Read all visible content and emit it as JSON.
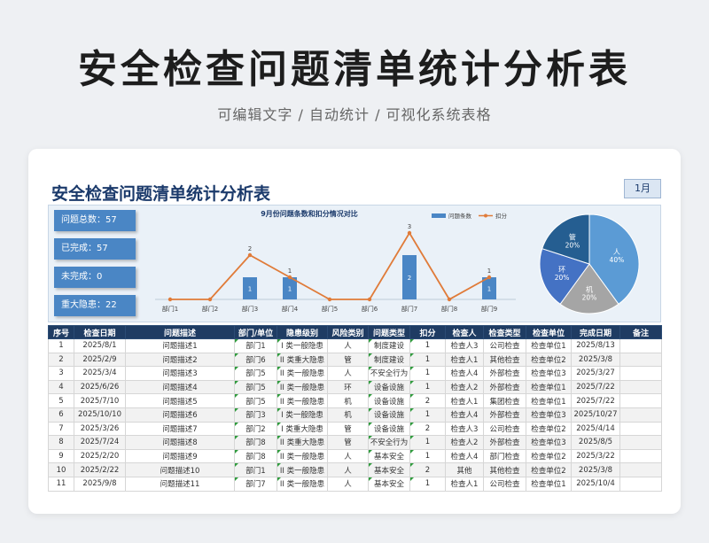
{
  "hero": {
    "title": "安全检查问题清单统计分析表",
    "subtitle": "可编辑文字 / 自动统计 / 可视化系统表格"
  },
  "sheet": {
    "title": "安全检查问题清单统计分析表",
    "month": "1月"
  },
  "stats": [
    {
      "label": "问题总数：57"
    },
    {
      "label": "已完成：57"
    },
    {
      "label": "未完成：0"
    },
    {
      "label": "重大隐患：22"
    }
  ],
  "colors": {
    "bar": "#4a86c5",
    "line": "#e07b39",
    "header": "#1f3c63",
    "accent": "#1b3a6b"
  },
  "chart_data": [
    {
      "type": "bar",
      "title": "9月份问题条数和扣分情况对比",
      "categories": [
        "部门1",
        "部门2",
        "部门3",
        "部门4",
        "部门5",
        "部门6",
        "部门7",
        "部门8",
        "部门9"
      ],
      "series": [
        {
          "name": "问题条数",
          "type": "bar",
          "values": [
            0,
            0,
            1,
            1,
            0,
            0,
            2,
            0,
            1
          ]
        },
        {
          "name": "扣分",
          "type": "line",
          "values": [
            0,
            0,
            2,
            1,
            0,
            0,
            3,
            0,
            1
          ]
        }
      ],
      "legend": "top-right",
      "grid": false
    },
    {
      "type": "pie",
      "slices": [
        {
          "label": "人",
          "value": 40,
          "text": "40%",
          "color": "#5b9bd5"
        },
        {
          "label": "机",
          "value": 20,
          "text": "20%",
          "color": "#a5a5a5"
        },
        {
          "label": "环",
          "value": 20,
          "text": "20%",
          "color": "#4472c4"
        },
        {
          "label": "管",
          "value": 20,
          "text": "20%",
          "color": "#255e91"
        }
      ]
    }
  ],
  "table": {
    "headers": [
      "序号",
      "检查日期",
      "问题描述",
      "部门/单位",
      "隐患级别",
      "风险类别",
      "问题类型",
      "扣分",
      "检查人",
      "检查类型",
      "检查单位",
      "完成日期",
      "备注"
    ],
    "rows": [
      [
        "1",
        "2025/8/1",
        "问题描述1",
        "部门1",
        "I 类一般隐患",
        "人",
        "制度建设",
        "1",
        "检查人3",
        "公司检查",
        "检查单位1",
        "2025/8/13",
        ""
      ],
      [
        "2",
        "2025/2/9",
        "问题描述2",
        "部门6",
        "II 类重大隐患",
        "管",
        "制度建设",
        "1",
        "检查人1",
        "其他检查",
        "检查单位2",
        "2025/3/8",
        ""
      ],
      [
        "3",
        "2025/3/4",
        "问题描述3",
        "部门5",
        "II 类一般隐患",
        "人",
        "不安全行为",
        "1",
        "检查人4",
        "外部检查",
        "检查单位3",
        "2025/3/27",
        ""
      ],
      [
        "4",
        "2025/6/26",
        "问题描述4",
        "部门5",
        "II 类一般隐患",
        "环",
        "设备设施",
        "1",
        "检查人2",
        "外部检查",
        "检查单位1",
        "2025/7/22",
        ""
      ],
      [
        "5",
        "2025/7/10",
        "问题描述5",
        "部门5",
        "II 类一般隐患",
        "机",
        "设备设施",
        "2",
        "检查人1",
        "集团检查",
        "检查单位1",
        "2025/7/22",
        ""
      ],
      [
        "6",
        "2025/10/10",
        "问题描述6",
        "部门3",
        "I 类一般隐患",
        "机",
        "设备设施",
        "1",
        "检查人4",
        "外部检查",
        "检查单位3",
        "2025/10/27",
        ""
      ],
      [
        "7",
        "2025/3/26",
        "问题描述7",
        "部门2",
        "I 类重大隐患",
        "管",
        "设备设施",
        "2",
        "检查人3",
        "公司检查",
        "检查单位2",
        "2025/4/14",
        ""
      ],
      [
        "8",
        "2025/7/24",
        "问题描述8",
        "部门8",
        "II 类重大隐患",
        "管",
        "不安全行为",
        "1",
        "检查人2",
        "外部检查",
        "检查单位3",
        "2025/8/5",
        ""
      ],
      [
        "9",
        "2025/2/20",
        "问题描述9",
        "部门8",
        "II 类一般隐患",
        "人",
        "基本安全",
        "1",
        "检查人4",
        "部门检查",
        "检查单位2",
        "2025/3/22",
        ""
      ],
      [
        "10",
        "2025/2/22",
        "问题描述10",
        "部门1",
        "II 类一般隐患",
        "人",
        "基本安全",
        "2",
        "其他",
        "其他检查",
        "检查单位2",
        "2025/3/8",
        ""
      ],
      [
        "11",
        "2025/9/8",
        "问题描述11",
        "部门7",
        "II 类一般隐患",
        "人",
        "基本安全",
        "1",
        "检查人1",
        "公司检查",
        "检查单位1",
        "2025/10/4",
        ""
      ]
    ]
  }
}
